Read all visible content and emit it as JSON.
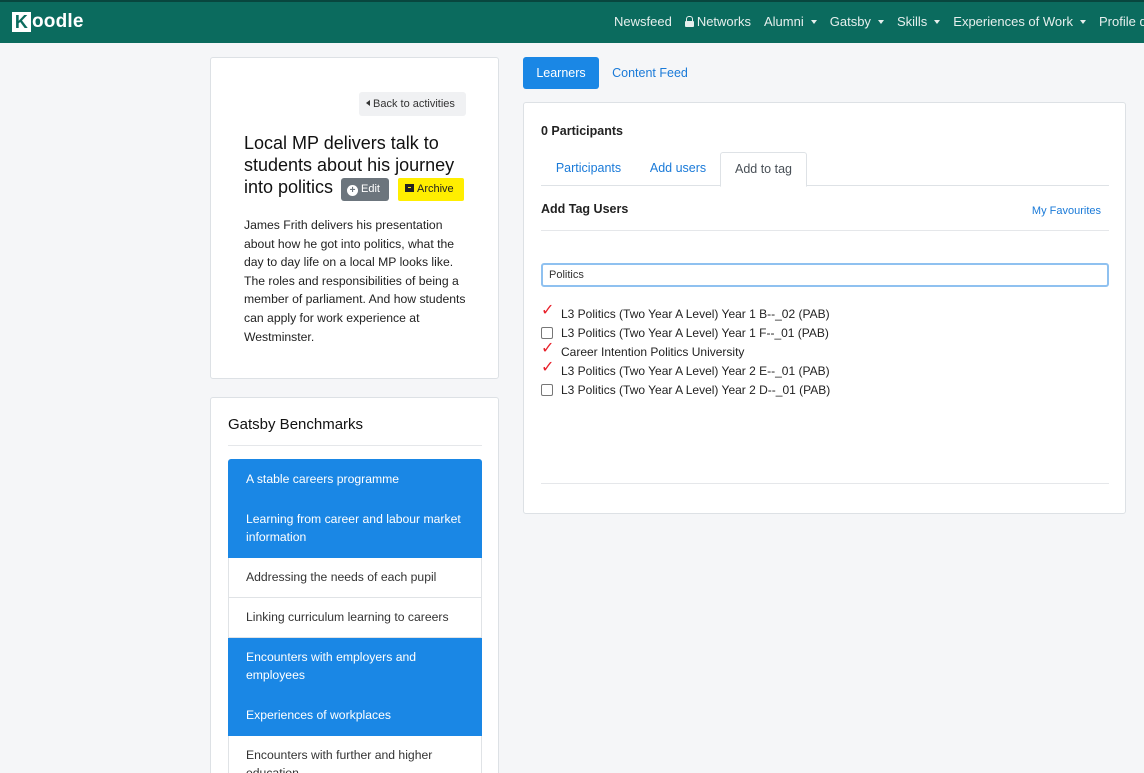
{
  "navbar": {
    "brand_letter": "K",
    "brand_rest": "oodle",
    "items": [
      {
        "label": "Newsfeed",
        "caret": false
      },
      {
        "label": "Networks",
        "caret": false,
        "icon": "lock-icon"
      },
      {
        "label": "Alumni",
        "caret": true
      },
      {
        "label": "Gatsby",
        "caret": true
      },
      {
        "label": "Skills",
        "caret": true
      },
      {
        "label": "Experiences of Work",
        "caret": true
      },
      {
        "label": "Profile data",
        "caret": false
      }
    ]
  },
  "activity": {
    "back_label": "Back to activities",
    "title": "Local MP delivers talk to students about his journey into politics",
    "edit_label": "Edit",
    "archive_label": "Archive",
    "description": "James Frith delivers his presentation about how he got into politics, what the day to day life on a local MP looks like. The roles and responsibilities of being a member of parliament. And how students can apply for work experience at Westminster."
  },
  "gatsby": {
    "title": "Gatsby Benchmarks",
    "items": [
      {
        "label": "A stable careers programme",
        "active": true
      },
      {
        "label": "Learning from career and labour market information",
        "active": true
      },
      {
        "label": "Addressing the needs of each pupil",
        "active": false
      },
      {
        "label": "Linking curriculum learning to careers",
        "active": false
      },
      {
        "label": "Encounters with employers and employees",
        "active": true
      },
      {
        "label": "Experiences of workplaces",
        "active": true
      },
      {
        "label": "Encounters with further and higher education",
        "active": false
      }
    ]
  },
  "view_tabs": {
    "learners": "Learners",
    "content_feed": "Content Feed"
  },
  "learners": {
    "participants_count": "0 Participants",
    "tabs": [
      "Participants",
      "Add users",
      "Add to tag"
    ],
    "active_tab": "Add to tag",
    "add_tag_title": "Add Tag Users",
    "favourites_link": "My Favourites",
    "search_value": "Politics",
    "tags": [
      {
        "label": "L3 Politics (Two Year A Level) Year 1 B--_02 (PAB)",
        "checked": true
      },
      {
        "label": "L3 Politics (Two Year A Level) Year 1 F--_01 (PAB)",
        "checked": false
      },
      {
        "label": "Career Intention Politics University",
        "checked": true
      },
      {
        "label": "L3 Politics (Two Year A Level) Year 2 E--_01 (PAB)",
        "checked": true
      },
      {
        "label": "L3 Politics (Two Year A Level) Year 2 D--_01 (PAB)",
        "checked": false
      }
    ]
  },
  "colors": {
    "navbar": "#0b6b5e",
    "primary": "#1a87e5",
    "archive": "#ffee00",
    "tick": "#e8202a"
  }
}
